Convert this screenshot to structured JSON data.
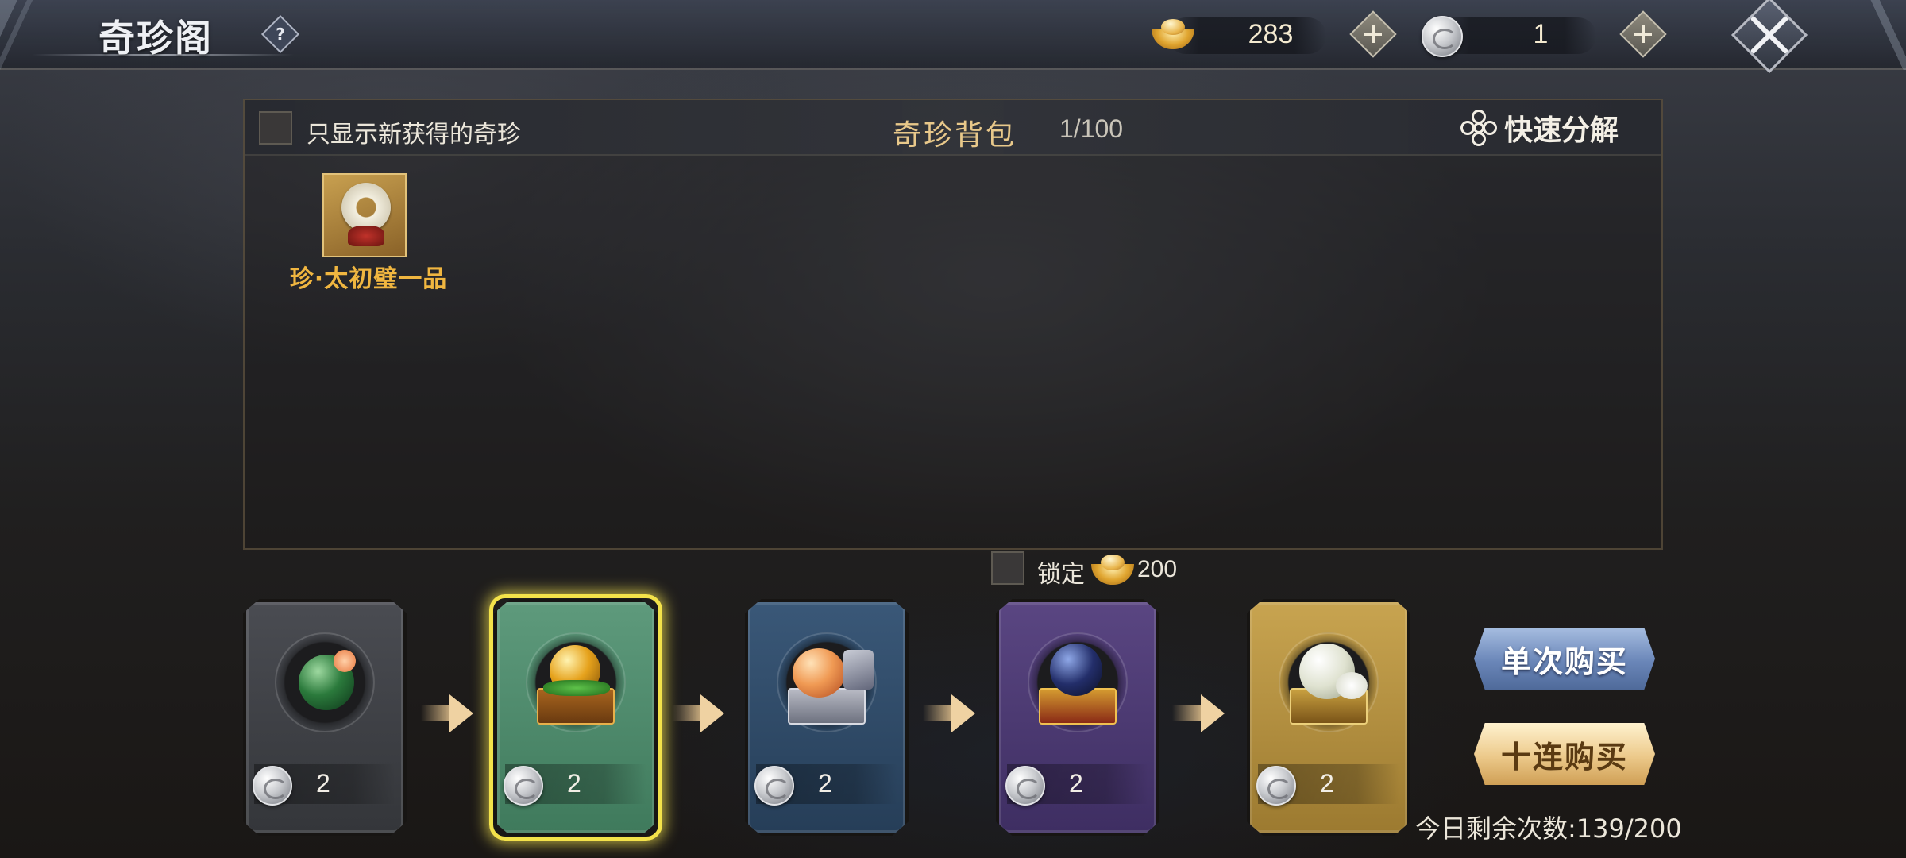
{
  "header": {
    "title": "奇珍阁",
    "help_label": "?",
    "currencies": [
      {
        "icon": "gold-ingot-icon",
        "value": "283"
      },
      {
        "icon": "silver-coin-icon",
        "value": "1"
      }
    ]
  },
  "bag": {
    "filter_label": "只显示新获得的奇珍",
    "filter_checked": false,
    "title": "奇珍背包",
    "count": "1/100",
    "quick_decompose_label": "快速分解",
    "items": [
      {
        "name": "珍·太初璧一品",
        "icon": "jade-disc-icon"
      }
    ]
  },
  "lock": {
    "label": "锁定",
    "checked": false,
    "cost": "200"
  },
  "tiers": [
    {
      "color": "gray",
      "price": "2",
      "icon": "green-orb-icon"
    },
    {
      "color": "green",
      "price": "2",
      "icon": "gold-orb-chest-icon",
      "selected": true
    },
    {
      "color": "blue",
      "price": "2",
      "icon": "peach-chest-icon"
    },
    {
      "color": "purple",
      "price": "2",
      "icon": "dark-orb-chest-icon"
    },
    {
      "color": "gold",
      "price": "2",
      "icon": "pearl-chest-icon"
    }
  ],
  "buttons": {
    "single_buy": "单次购买",
    "ten_buy": "十连购买"
  },
  "remaining": "今日剩余次数:139/200",
  "colors": {
    "accent_gold": "#e8c88a",
    "item_name_gold": "#f0b640",
    "selection_yellow": "#f3e24a"
  }
}
